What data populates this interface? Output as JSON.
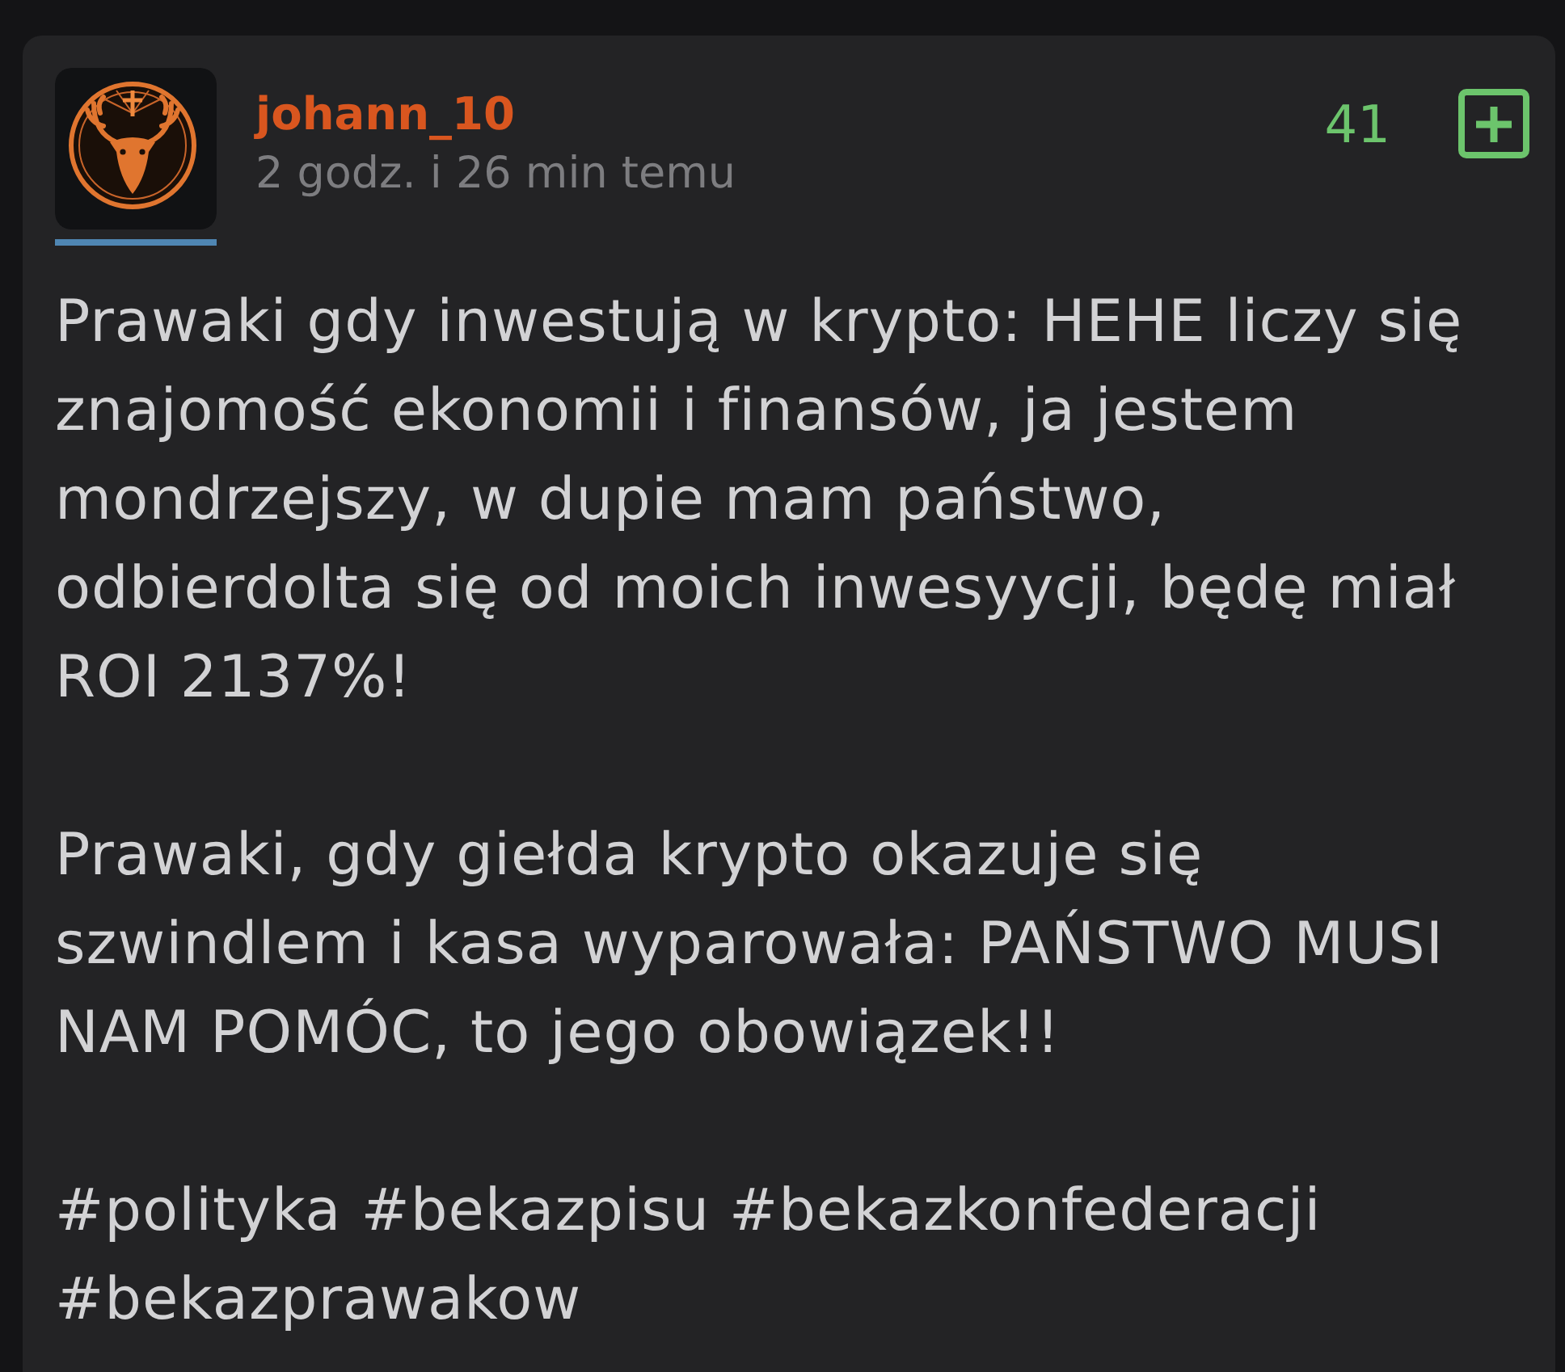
{
  "entry": {
    "author": {
      "name": "johann_10"
    },
    "time": "2 godz. i 26 min temu",
    "votes": {
      "count": "41"
    },
    "paragraphs": [
      "Prawaki gdy inwestują w krypto: HEHE liczy się znajomość ekonomii i finansów, ja jestem mondrzejszy, w dupie mam państwo, odbierdolta się od moich inwesyycji, będę miał ROI 2137%!",
      "Prawaki, gdy giełda krypto okazuje się szwindlem i kasa wyparowała: PAŃSTWO MUSI NAM POMÓC, to jego obowiązek!!"
    ],
    "tags": [
      "#polityka",
      "#bekazpisu",
      "#bekazkonfederacji",
      "#bekazprawakow"
    ]
  }
}
